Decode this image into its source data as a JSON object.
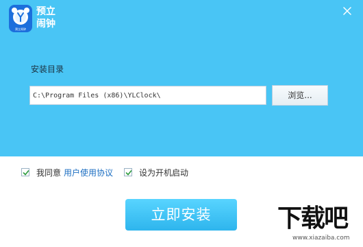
{
  "app": {
    "name_line1": "预立",
    "name_line2": "闹钟",
    "logo_small_text": "预立闹钟",
    "brand_color": "#49c5f5",
    "logo_color": "#1c6fdc"
  },
  "window": {
    "close_icon": "close-icon"
  },
  "install_dir": {
    "label": "安装目录",
    "path": "C:\\Program Files (x86)\\YLClock\\",
    "browse_label": "浏览..."
  },
  "options": {
    "agree_prefix": "我同意",
    "agreement_link": "用户使用协议",
    "agree_checked": true,
    "autostart_label": "设为开机启动",
    "autostart_checked": true
  },
  "actions": {
    "install_label": "立即安装"
  },
  "watermark": {
    "text": "下载吧",
    "url": "www.xiazaiba.com"
  }
}
